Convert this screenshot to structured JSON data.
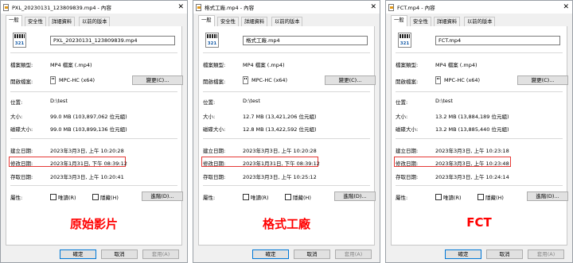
{
  "tabs": [
    "一般",
    "安全性",
    "詳細資料",
    "以前的版本"
  ],
  "labels": {
    "file_type": "檔案類型:",
    "opens_with": "開啟檔案:",
    "location": "位置:",
    "size": "大小:",
    "size_on_disk": "磁碟大小:",
    "created": "建立日期:",
    "modified": "修改日期:",
    "accessed": "存取日期:",
    "attributes": "屬性:"
  },
  "buttons": {
    "change": "變更(C)...",
    "advanced": "進階(D)...",
    "ok": "確定",
    "cancel": "取消",
    "apply": "套用(A)"
  },
  "checkboxes": {
    "readonly": "唯讀(R)",
    "hidden": "隱藏(H)"
  },
  "icons": {
    "close": "✕",
    "thumb_number": "321"
  },
  "colors": {
    "highlight": "#e53935",
    "caption": "#ff0000"
  },
  "panels": [
    {
      "title": "PXL_20230131_123809839.mp4 - 內容",
      "filename": "PXL_20230131_123809839.mp4",
      "file_type": "MP4 檔案 (.mp4)",
      "opens_with": "MPC-HC (x64)",
      "location": "D:\\test",
      "size": "99.0 MB (103,897,062 位元組)",
      "size_on_disk": "99.0 MB (103,899,136 位元組)",
      "created": "2023年3月3日, 上午 10:20:28",
      "modified": "2023年1月31日, 下午 08:39:12",
      "accessed": "2023年3月3日, 上午 10:20:41",
      "caption": "原始影片"
    },
    {
      "title": "格式工廠.mp4 - 內容",
      "filename": "格式工廠.mp4",
      "file_type": "MP4 檔案 (.mp4)",
      "opens_with": "MPC-HC (x64)",
      "location": "D:\\test",
      "size": "12.7 MB (13,421,206 位元組)",
      "size_on_disk": "12.8 MB (13,422,592 位元組)",
      "created": "2023年3月3日, 上午 10:20:28",
      "modified": "2023年1月31日, 下午 08:39:12",
      "accessed": "2023年3月3日, 上午 10:25:12",
      "caption": "格式工廠"
    },
    {
      "title": "FCT.mp4 - 內容",
      "filename": "FCT.mp4",
      "file_type": "MP4 檔案 (.mp4)",
      "opens_with": "MPC-HC (x64)",
      "location": "D:\\test",
      "size": "13.2 MB (13,884,189 位元組)",
      "size_on_disk": "13.2 MB (13,885,440 位元組)",
      "created": "2023年3月3日, 上午 10:23:18",
      "modified": "2023年3月3日, 上午 10:23:48",
      "accessed": "2023年3月3日, 上午 10:24:14",
      "caption": "FCT"
    }
  ]
}
